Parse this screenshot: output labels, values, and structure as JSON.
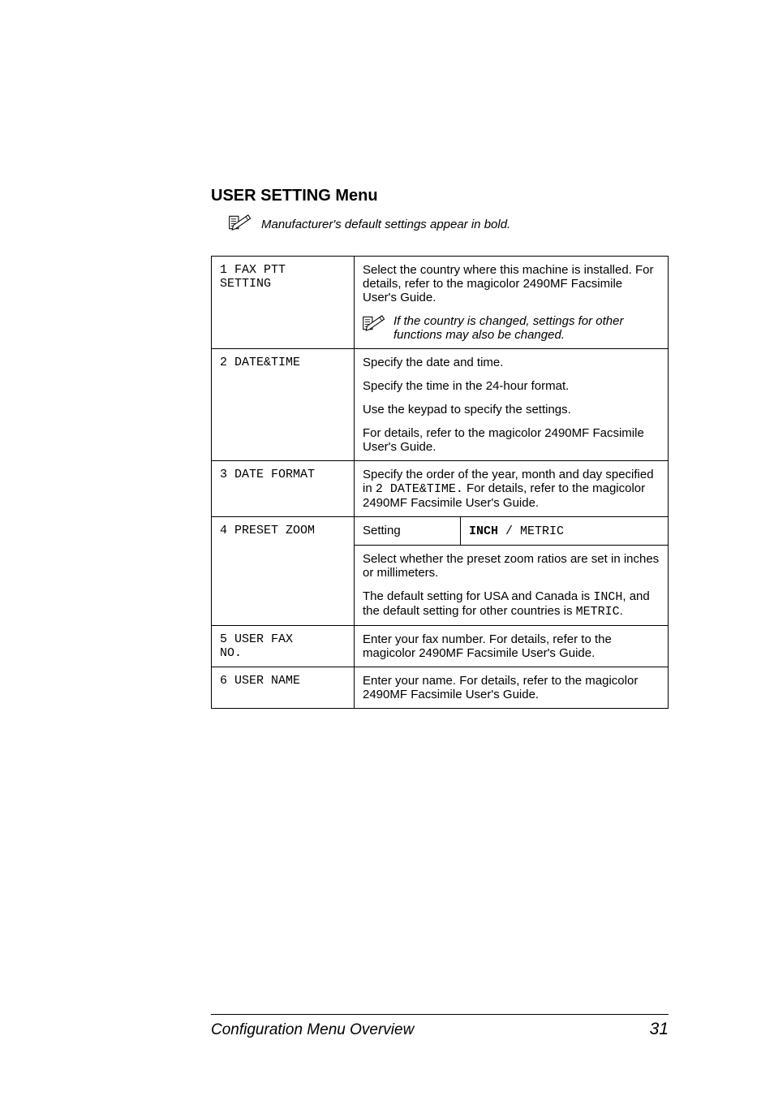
{
  "section_title": "USER SETTING Menu",
  "top_note": "Manufacturer's default settings appear in bold.",
  "rows": {
    "r1": {
      "key": "1 FAX PTT\nSETTING",
      "para1": "Select the country where this machine is installed. For details, refer to the magicolor 2490MF Facsimile User's Guide.",
      "note_l1": "If the country is changed, settings for other",
      "note_l2": "functions may also be changed."
    },
    "r2": {
      "key": "2 DATE&TIME",
      "p1": "Specify the date and time.",
      "p2": "Specify the time in the 24-hour format.",
      "p3": "Use the keypad to specify the settings.",
      "p4": "For details, refer to the magicolor 2490MF Facsimile User's Guide."
    },
    "r3": {
      "key": "3 DATE FORMAT",
      "p1a": "Specify the order of the year, month and day specified in ",
      "p1b": "2 DATE&TIME.",
      "p1c": " For details, refer to the magicolor 2490MF Facsimile User's Guide."
    },
    "r4": {
      "key": "4 PRESET ZOOM",
      "setting_label": "Setting",
      "opt_bold": "INCH",
      "opt_sep": " / ",
      "opt2": "METRIC",
      "p1": "Select whether the preset zoom ratios are set in inches or millimeters.",
      "p2a": "The default setting for USA and Canada is ",
      "p2b": "INCH",
      "p2c": ", and the default setting for other countries is ",
      "p2d": "METRIC",
      "p2e": "."
    },
    "r5": {
      "key": "5 USER FAX\nNO.",
      "p1": "Enter your fax number. For details, refer to the magicolor 2490MF Facsimile User's Guide."
    },
    "r6": {
      "key": "6 USER NAME",
      "p1": "Enter your name. For details, refer to the magicolor 2490MF Facsimile User's Guide."
    }
  },
  "footer": {
    "title": "Configuration Menu Overview",
    "page": "31"
  }
}
